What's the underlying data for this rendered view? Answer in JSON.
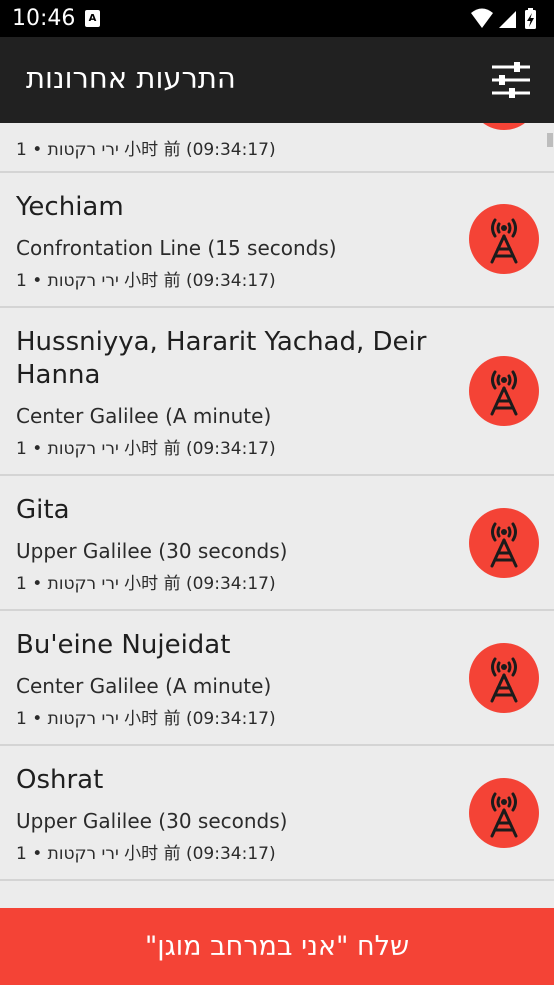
{
  "status_bar": {
    "time": "10:46",
    "notification_icon": "A"
  },
  "app_bar": {
    "title": "התרעות אחרונות",
    "filter_icon": "sliders-icon"
  },
  "alerts": [
    {
      "city": "",
      "zone": "",
      "meta": "ירי רקטות • 1 小时 前 (09:34:17)"
    },
    {
      "city": "Yechiam",
      "zone": "Confrontation Line (15 seconds)",
      "meta": "ירי רקטות • 1 小时 前 (09:34:17)"
    },
    {
      "city": "Hussniyya, Hararit Yachad, Deir Hanna",
      "zone": "Center Galilee (A minute)",
      "meta": "ירי רקטות • 1 小时 前 (09:34:17)"
    },
    {
      "city": "Gita",
      "zone": "Upper Galilee (30 seconds)",
      "meta": "ירי רקטות • 1 小时 前 (09:34:17)"
    },
    {
      "city": "Bu'eine Nujeidat",
      "zone": "Center Galilee (A minute)",
      "meta": "ירי רקטות • 1 小时 前 (09:34:17)"
    },
    {
      "city": "Oshrat",
      "zone": "Upper Galilee (30 seconds)",
      "meta": "ירי רקטות • 1 小时 前 (09:34:17)"
    }
  ],
  "colors": {
    "accent": "#f44336",
    "appbar": "#212121"
  },
  "bottom_button": {
    "label": "שלח \"אני במרחב מוגן\""
  }
}
